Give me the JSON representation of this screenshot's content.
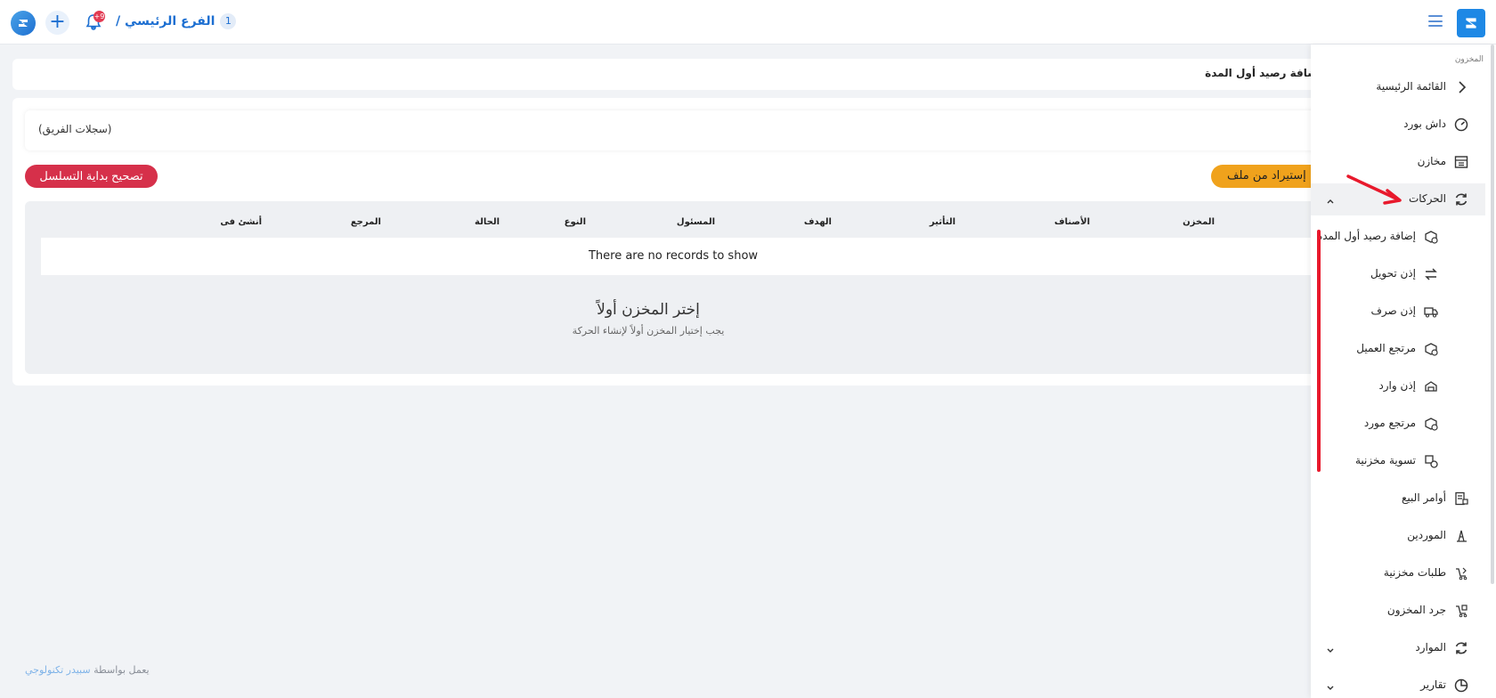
{
  "topbar": {
    "branch_name": "الفرع الرئيسي /",
    "branch_number": "1",
    "notification_count": "+9"
  },
  "page": {
    "title": "إضافة رصيد أول المدة"
  },
  "team_log": {
    "label": "(سجلات الفريق)"
  },
  "actions": {
    "fix_sequence": "تصحيح بداية التسلسل",
    "import_file": "إستيراد من ملف"
  },
  "table": {
    "headers": [
      "المخزن",
      "الأصناف",
      "التأثير",
      "الهدف",
      "المسئول",
      "النوع",
      "الحالة",
      "المرجع",
      "أنشئ فى"
    ],
    "empty_message": "There are no records to show"
  },
  "empty_state": {
    "title": "إختر المخزن أولاً",
    "subtitle": "يجب إختيار المخزن أولاً لإنشاء الحركة"
  },
  "footer": {
    "powered_by": "يعمل بواسطة",
    "brand": "سبيدر تكنولوجي"
  },
  "sidebar": {
    "section": "المخزون",
    "items": [
      {
        "label": "القائمة الرئيسية",
        "icon": "chevron-right-icon"
      },
      {
        "label": "داش بورد",
        "icon": "speedometer-icon"
      },
      {
        "label": "مخازن",
        "icon": "warehouse-icon"
      },
      {
        "label": "الحركات",
        "icon": "refresh-icon",
        "expanded": true
      },
      {
        "label": "إضافة رصيد أول المدة",
        "icon": "box-add-icon",
        "sub": true
      },
      {
        "label": "إذن تحويل",
        "icon": "transfer-icon",
        "sub": true
      },
      {
        "label": "إذن صرف",
        "icon": "truck-icon",
        "sub": true
      },
      {
        "label": "مرتجع العميل",
        "icon": "box-return-icon",
        "sub": true
      },
      {
        "label": "إذن وارد",
        "icon": "inbound-icon",
        "sub": true
      },
      {
        "label": "مرتجع مورد",
        "icon": "box-supplier-icon",
        "sub": true
      },
      {
        "label": "تسوية مخزنية",
        "icon": "adjust-icon",
        "sub": true
      },
      {
        "label": "أوامر البيع",
        "icon": "sales-order-icon"
      },
      {
        "label": "الموردين",
        "icon": "supplier-icon"
      },
      {
        "label": "طلبات مخزنية",
        "icon": "stock-request-icon"
      },
      {
        "label": "جرد المخزون",
        "icon": "stocktake-icon"
      },
      {
        "label": "الموارد",
        "icon": "resources-icon",
        "collapsible": true
      },
      {
        "label": "تقارير",
        "icon": "reports-icon",
        "collapsible": true
      }
    ]
  }
}
